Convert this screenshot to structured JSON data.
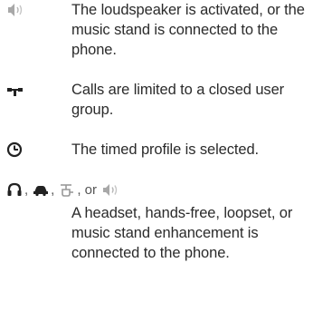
{
  "entries": [
    {
      "icon": "loudspeaker-icon",
      "text": "The loudspeaker is activated, or the music stand is connected to the phone."
    },
    {
      "icon": "closed-user-group-icon",
      "text": "Calls are limited to a closed user group."
    },
    {
      "icon": "timed-profile-clock-icon",
      "text": "The timed profile is selected."
    },
    {
      "icons": [
        "headset-icon",
        "hands-free-car-icon",
        "loopset-icon",
        "music-stand-icon"
      ],
      "separators": [
        ",",
        ",",
        ", or"
      ],
      "text": "A headset, hands-free, loopset, or music stand enhancement is connected to the phone."
    }
  ],
  "colors": {
    "text": "#2b2b2b",
    "icon_dark": "#222222",
    "icon_light": "#9a9a9a"
  }
}
